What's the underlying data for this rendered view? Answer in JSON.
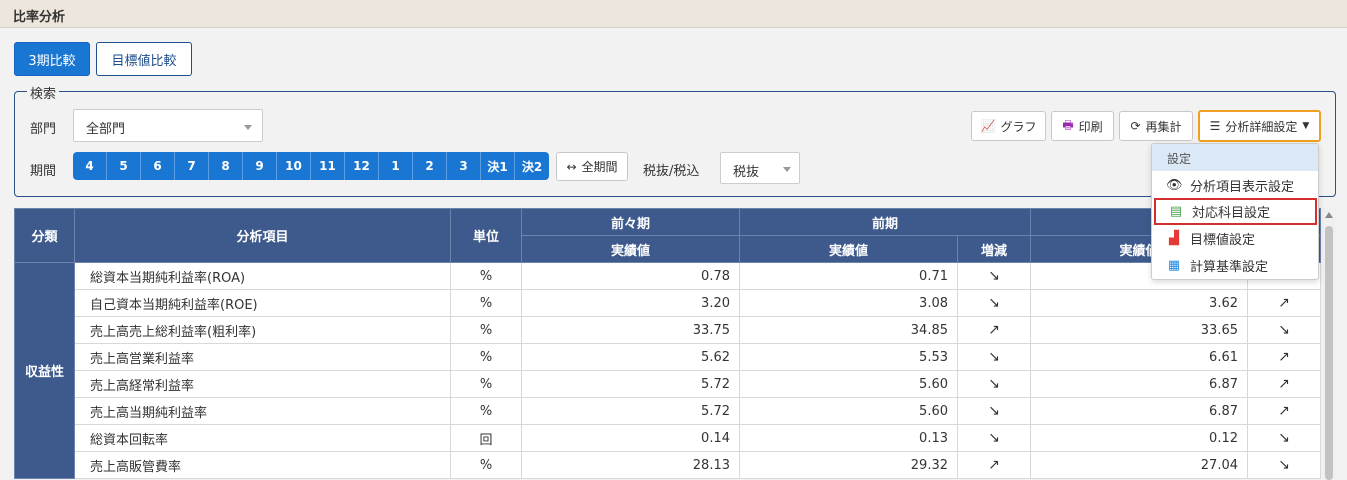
{
  "page": {
    "title": "比率分析"
  },
  "tabs": {
    "compare3": "3期比較",
    "target": "目標値比較"
  },
  "search": {
    "legend": "検索",
    "dept_label": "部門",
    "dept_value": "全部門",
    "period_label": "期間",
    "periods": [
      "4",
      "5",
      "6",
      "7",
      "8",
      "9",
      "10",
      "11",
      "12",
      "1",
      "2",
      "3",
      "決1",
      "決2"
    ],
    "all_period": "全期間",
    "tax_label": "税抜/税込",
    "tax_value": "税抜"
  },
  "toolbar": {
    "graph": "グラフ",
    "print": "印刷",
    "recalc": "再集計",
    "detail": "分析詳細設定"
  },
  "menu": {
    "header": "設定",
    "items": [
      "分析項目表示設定",
      "対応科目設定",
      "目標値設定",
      "計算基準設定"
    ]
  },
  "table": {
    "headers": {
      "category": "分類",
      "item": "分析項目",
      "unit": "単位",
      "prev2": "前々期",
      "prev": "前期",
      "actual": "実績値",
      "change": "増減",
      "current_actual": "実績値"
    },
    "category": "収益性",
    "rows": [
      {
        "name": "総資本当期純利益率(ROA)",
        "unit": "%",
        "prev2": "0.78",
        "prev": "0.71",
        "prev_arrow": "↘",
        "cur": "",
        "cur_arrow": ""
      },
      {
        "name": "自己資本当期純利益率(ROE)",
        "unit": "%",
        "prev2": "3.20",
        "prev": "3.08",
        "prev_arrow": "↘",
        "cur": "3.62",
        "cur_arrow": "↗"
      },
      {
        "name": "売上高売上総利益率(粗利率)",
        "unit": "%",
        "prev2": "33.75",
        "prev": "34.85",
        "prev_arrow": "↗",
        "cur": "33.65",
        "cur_arrow": "↘"
      },
      {
        "name": "売上高営業利益率",
        "unit": "%",
        "prev2": "5.62",
        "prev": "5.53",
        "prev_arrow": "↘",
        "cur": "6.61",
        "cur_arrow": "↗"
      },
      {
        "name": "売上高経常利益率",
        "unit": "%",
        "prev2": "5.72",
        "prev": "5.60",
        "prev_arrow": "↘",
        "cur": "6.87",
        "cur_arrow": "↗"
      },
      {
        "name": "売上高当期純利益率",
        "unit": "%",
        "prev2": "5.72",
        "prev": "5.60",
        "prev_arrow": "↘",
        "cur": "6.87",
        "cur_arrow": "↗"
      },
      {
        "name": "総資本回転率",
        "unit": "回",
        "prev2": "0.14",
        "prev": "0.13",
        "prev_arrow": "↘",
        "cur": "0.12",
        "cur_arrow": "↘"
      },
      {
        "name": "売上高販管費率",
        "unit": "%",
        "prev2": "28.13",
        "prev": "29.32",
        "prev_arrow": "↗",
        "cur": "27.04",
        "cur_arrow": "↘"
      }
    ]
  }
}
